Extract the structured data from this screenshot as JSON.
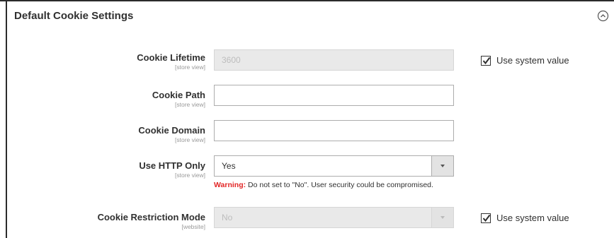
{
  "section": {
    "title": "Default Cookie Settings",
    "collapse_icon": "circle-chevron-up-icon"
  },
  "fields": [
    {
      "label": "Cookie Lifetime",
      "scope": "[store view]",
      "value": "3600",
      "disabled": true,
      "use_system_value": true
    },
    {
      "label": "Cookie Path",
      "scope": "[store view]",
      "value": "",
      "disabled": false
    },
    {
      "label": "Cookie Domain",
      "scope": "[store view]",
      "value": "",
      "disabled": false
    },
    {
      "label": "Use HTTP Only",
      "scope": "[store view]",
      "value": "Yes",
      "disabled": false
    },
    {
      "label": "Cookie Restriction Mode",
      "scope": "[website]",
      "value": "No",
      "disabled": true,
      "use_system_value": true
    }
  ],
  "system_value_label": "Use system value",
  "warning": {
    "prefix": "Warning:",
    "text": " Do not set to \"No\". User security could be compromised."
  }
}
